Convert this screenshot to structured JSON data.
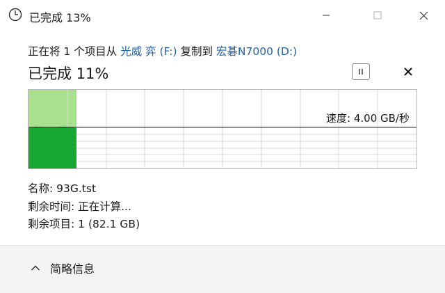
{
  "window": {
    "title": "已完成 13%",
    "icon": "clock-icon"
  },
  "copy": {
    "prefix": "正在将 1 个项目从 ",
    "source": "光威 弈 (F:)",
    "middle": " 复制到 ",
    "destination": "宏碁N7000 (D:)"
  },
  "progress": {
    "heading": "已完成 11%",
    "percent": 11,
    "speed_label": "速度: 4.00 GB/秒"
  },
  "details": {
    "name": "名称:  93G.tst",
    "time_remaining": "剩余时间:  正在计算...",
    "items_remaining": "剩余项目:  1 (82.1 GB)"
  },
  "footer": {
    "toggle_label": "简略信息"
  },
  "colors": {
    "progress_light": "#a8e08e",
    "speed_fill": "#17a832",
    "link": "#2563a8"
  }
}
